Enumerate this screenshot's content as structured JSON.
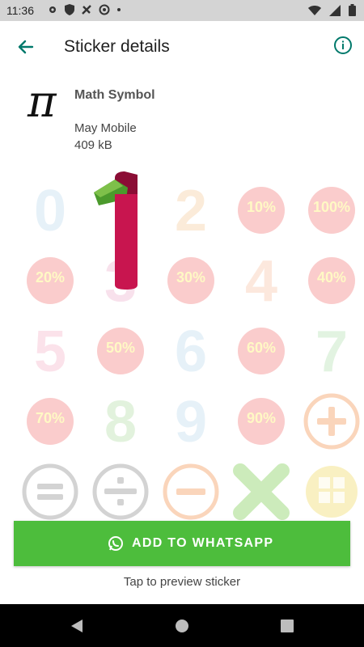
{
  "status_bar": {
    "time": "11:36"
  },
  "app_bar": {
    "title": "Sticker details"
  },
  "pack": {
    "name": "Math Symbol",
    "publisher": "May Mobile",
    "size": "409 kB",
    "tray_glyph": "π"
  },
  "stickers": [
    {
      "label": "0",
      "kind": "digit",
      "color": "#9ec8e6"
    },
    {
      "label": "1",
      "kind": "digit-selected",
      "color": "#c8154f"
    },
    {
      "label": "2",
      "kind": "digit",
      "color": "#f0b16a"
    },
    {
      "label": "10%",
      "kind": "percent",
      "color": "#f26d6d"
    },
    {
      "label": "100%",
      "kind": "percent",
      "color": "#f26d6d"
    },
    {
      "label": "20%",
      "kind": "percent",
      "color": "#f26d6d"
    },
    {
      "label": "3",
      "kind": "digit",
      "color": "#e58bb5"
    },
    {
      "label": "30%",
      "kind": "percent",
      "color": "#f26d6d"
    },
    {
      "label": "4",
      "kind": "digit",
      "color": "#f7a77a"
    },
    {
      "label": "40%",
      "kind": "percent",
      "color": "#f26d6d"
    },
    {
      "label": "5",
      "kind": "digit",
      "color": "#f08fb0"
    },
    {
      "label": "50%",
      "kind": "percent",
      "color": "#f26d6d"
    },
    {
      "label": "6",
      "kind": "digit",
      "color": "#9ec8e6"
    },
    {
      "label": "60%",
      "kind": "percent",
      "color": "#f26d6d"
    },
    {
      "label": "7",
      "kind": "digit",
      "color": "#8fd08a"
    },
    {
      "label": "70%",
      "kind": "percent",
      "color": "#f26d6d"
    },
    {
      "label": "8",
      "kind": "digit",
      "color": "#8fcf7a"
    },
    {
      "label": "9",
      "kind": "digit",
      "color": "#9ec8e6"
    },
    {
      "label": "90%",
      "kind": "percent",
      "color": "#f26d6d"
    },
    {
      "label": "+",
      "kind": "symbol",
      "color": "#f5a36a"
    },
    {
      "label": "=",
      "kind": "symbol",
      "color": "#9e9e9e"
    },
    {
      "label": "÷",
      "kind": "symbol",
      "color": "#9e9e9e"
    },
    {
      "label": "−",
      "kind": "symbol",
      "color": "#f5a36a"
    },
    {
      "label": "×",
      "kind": "symbol-x",
      "color": "#8fd46a"
    },
    {
      "label": "calculator",
      "kind": "calculator",
      "color": "#f2e07a"
    }
  ],
  "cta": {
    "label": "ADD TO WHATSAPP",
    "icon": "whatsapp-icon"
  },
  "hint": "Tap to preview sticker",
  "colors": {
    "accent": "#00796b",
    "cta": "#4dbd3c",
    "statusbar": "#d4d4d4",
    "navbar": "#000000"
  }
}
